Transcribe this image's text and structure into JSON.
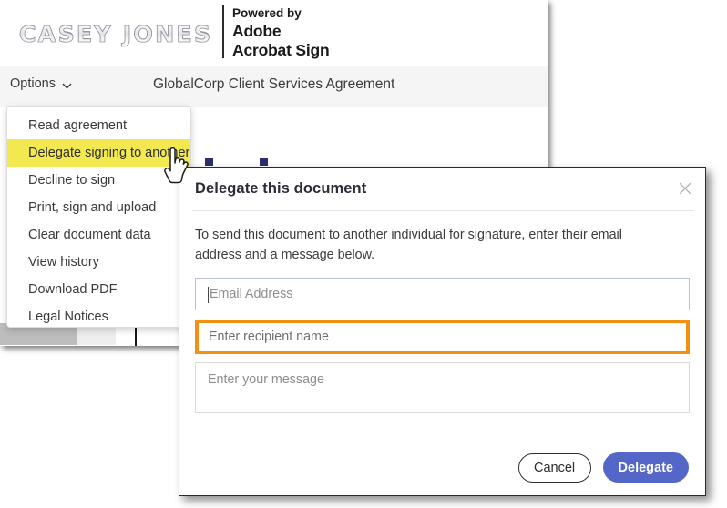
{
  "brand": {
    "logo_text": "CASEY JONES",
    "powered_by": "Powered by",
    "adobe": "Adobe",
    "product": "Acrobat Sign"
  },
  "toolbar": {
    "options_label": "Options",
    "chevron_icon": "chevron-down-icon",
    "document_title": "GlobalCorp Client Services Agreement"
  },
  "options_menu": {
    "items": [
      {
        "label": "Read agreement",
        "highlighted": false
      },
      {
        "label": "Delegate signing to another",
        "highlighted": true
      },
      {
        "label": "Decline to sign",
        "highlighted": false
      },
      {
        "label": "Print, sign and upload",
        "highlighted": false
      },
      {
        "label": "Clear document data",
        "highlighted": false
      },
      {
        "label": "View history",
        "highlighted": false
      },
      {
        "label": "Download PDF",
        "highlighted": false
      },
      {
        "label": "Legal Notices",
        "highlighted": false
      }
    ]
  },
  "cursor": {
    "icon": "pointing-hand-cursor"
  },
  "dialog": {
    "title": "Delegate this document",
    "close_icon": "close-icon",
    "instructions": "To send this document to another individual for signature, enter their email address and a message below.",
    "email_input": {
      "value": "",
      "placeholder": "Email Address"
    },
    "name_input": {
      "value": "",
      "placeholder": "Enter recipient name"
    },
    "message_input": {
      "value": "",
      "placeholder": "Enter your message"
    },
    "cancel_label": "Cancel",
    "delegate_label": "Delegate"
  },
  "colors": {
    "highlight_yellow": "#f2e84f",
    "focus_orange": "#f29111",
    "primary_blue": "#5566c9",
    "toolbar_gray": "#f5f5f5"
  }
}
